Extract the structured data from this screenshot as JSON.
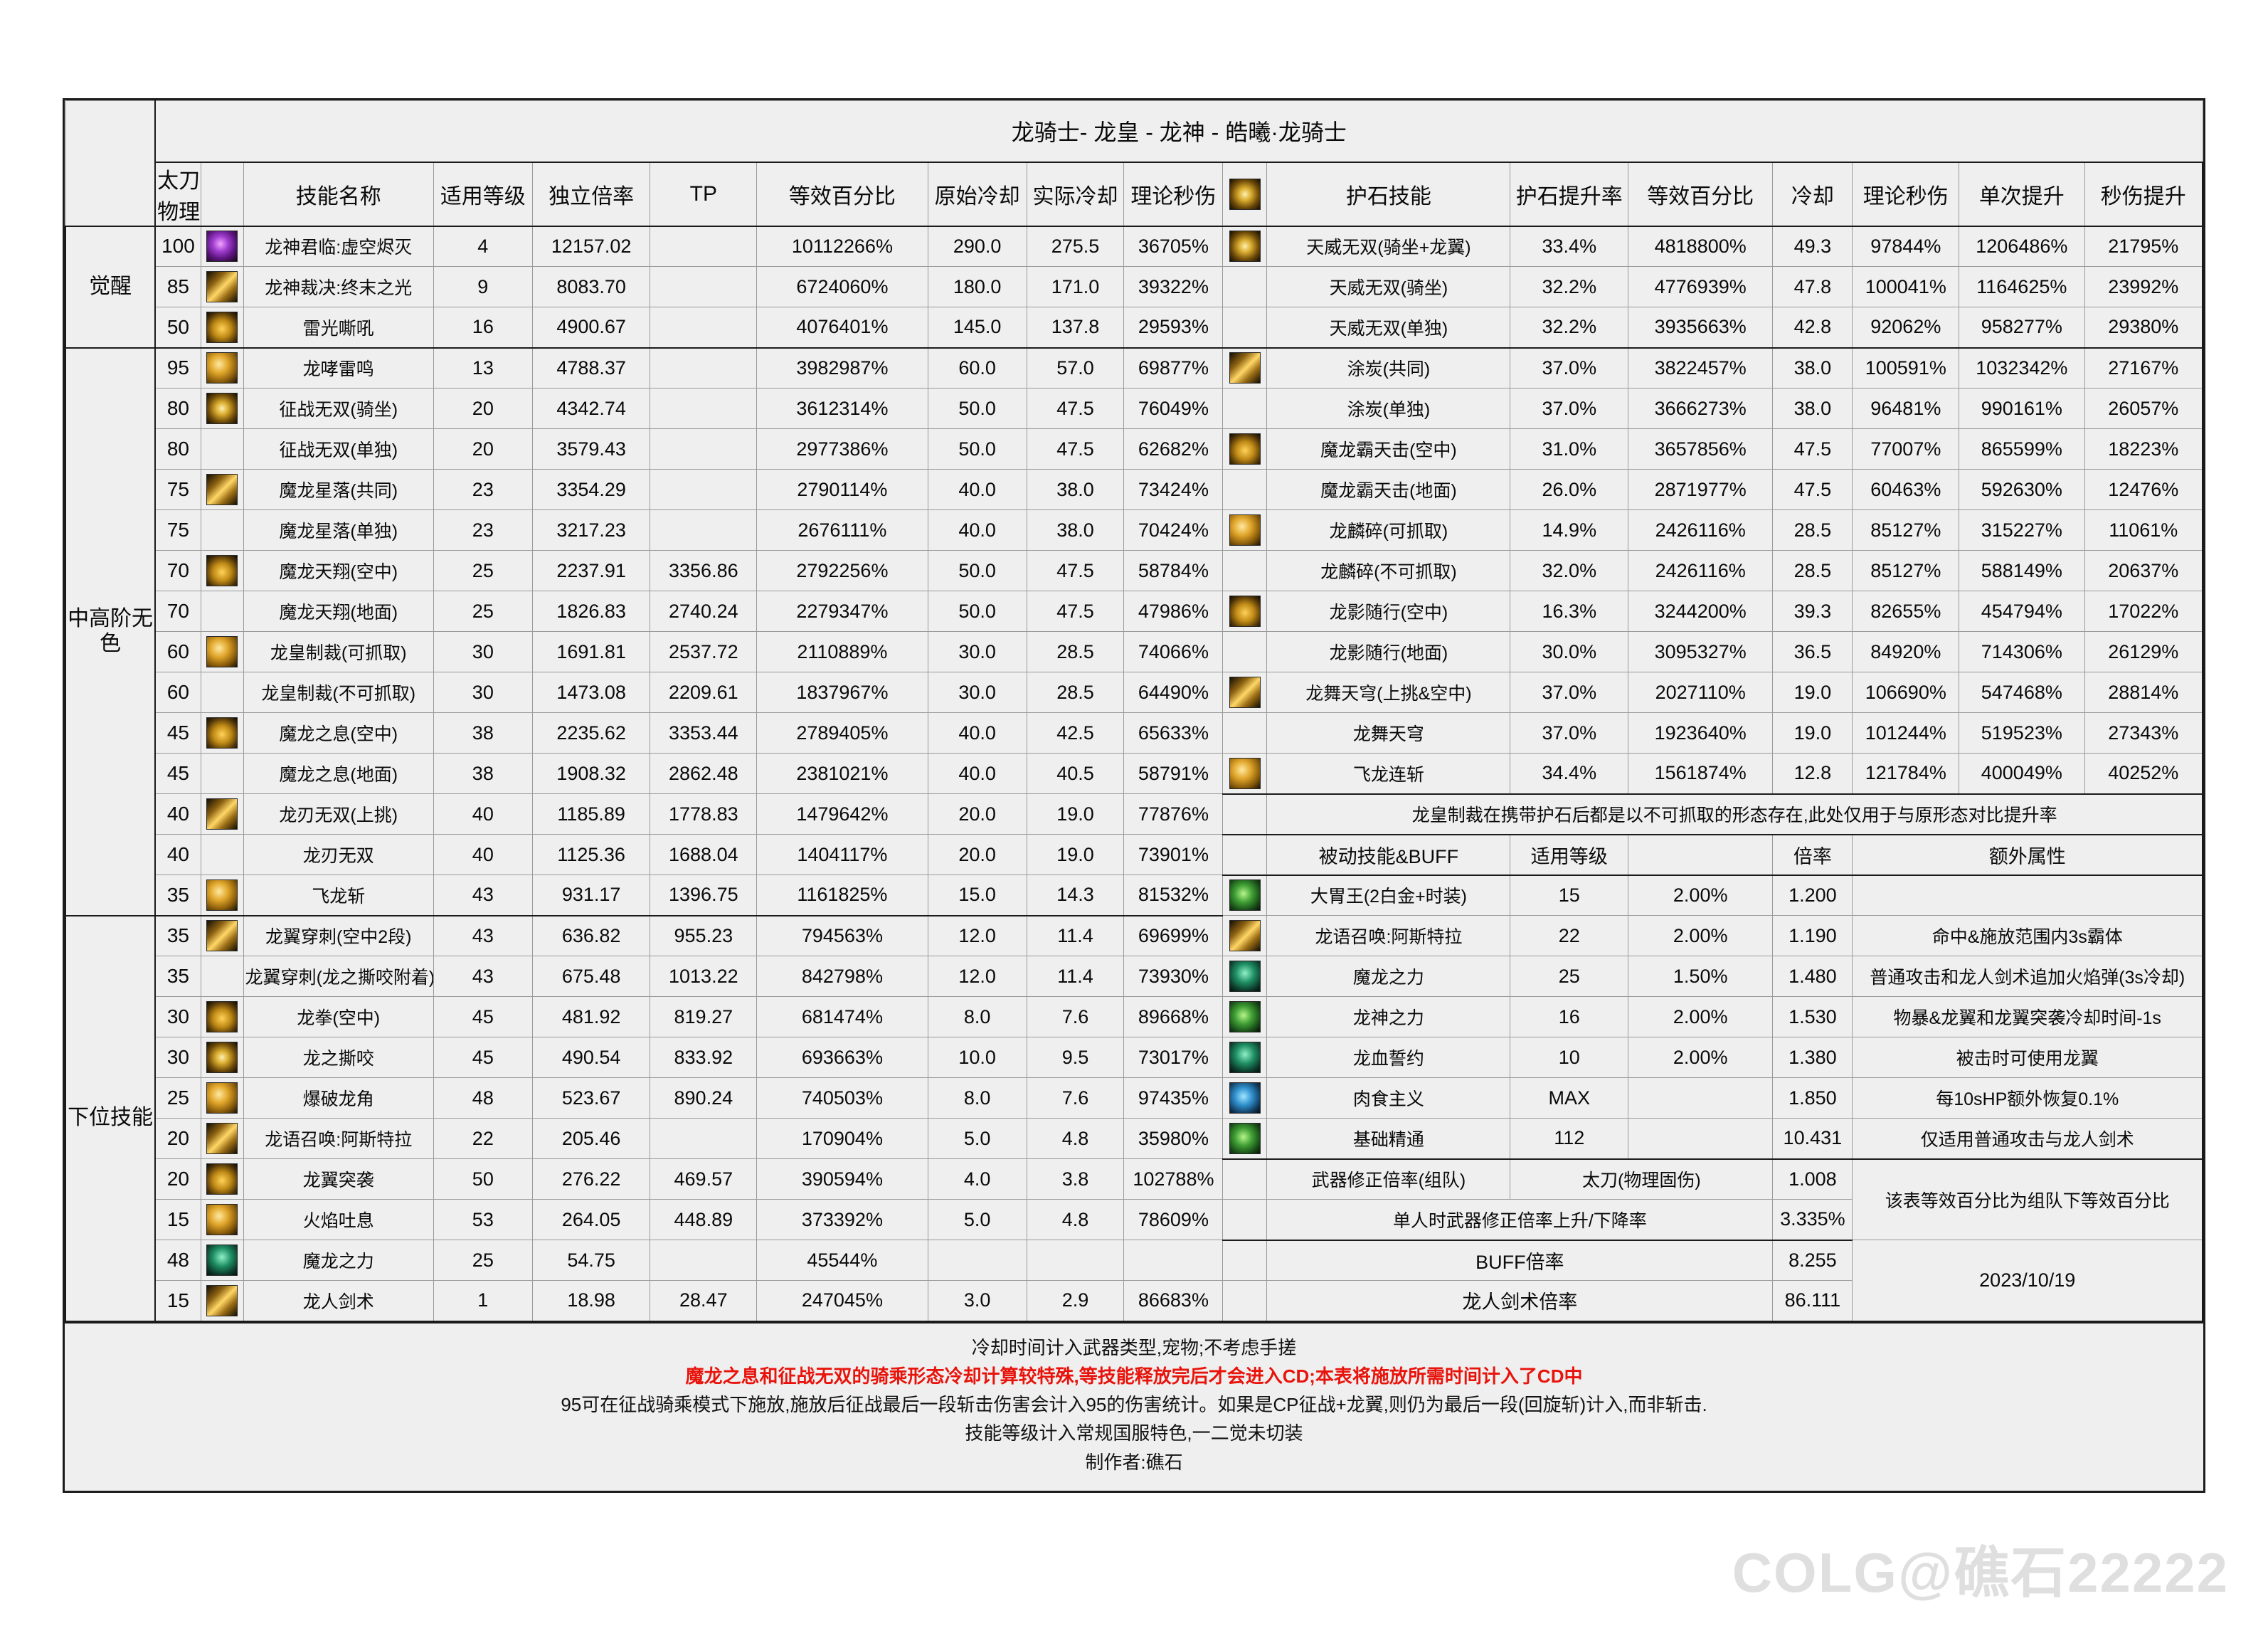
{
  "title": "龙骑士- 龙皇 - 龙神 - 皓曦·龙骑士",
  "headers": {
    "weapon": "太刀\n物理固伤",
    "weapon_l1": "太刀",
    "weapon_l2": "物理固伤",
    "skill_name": "技能名称",
    "apply_level": "适用等级",
    "independent_rate": "独立倍率",
    "tp": "TP",
    "equiv_percent": "等效百分比",
    "raw_cd": "原始冷却",
    "actual_cd": "实际冷却",
    "theoretical_dps": "理论秒伤",
    "rune_icon": "rune-star-icon",
    "rune_skill": "护石技能",
    "rune_rate": "护石提升率",
    "rune_equiv_percent": "等效百分比",
    "rune_cd": "冷却",
    "rune_dps": "理论秒伤",
    "single_gain": "单次提升",
    "dps_gain": "秒伤提升"
  },
  "groups": {
    "awakening": "觉醒",
    "mid_high": "中高阶无色",
    "lower": "下位技能"
  },
  "rows": [
    {
      "lvl": "100",
      "icon": "g-purple",
      "name": "龙神君临:虚空烬灭",
      "apply": "4",
      "rate": "12157.02",
      "tp": "",
      "equiv": "10112266%",
      "rawcd": "290.0",
      "cd": "275.5",
      "dps": "36705%"
    },
    {
      "lvl": "85",
      "icon": "g-gold2",
      "name": "龙神裁决:终末之光",
      "apply": "9",
      "rate": "8083.70",
      "tp": "",
      "equiv": "6724060%",
      "rawcd": "180.0",
      "cd": "171.0",
      "dps": "39322%"
    },
    {
      "lvl": "50",
      "icon": "g-amber",
      "name": "雷光嘶吼",
      "apply": "16",
      "rate": "4900.67",
      "tp": "",
      "equiv": "4076401%",
      "rawcd": "145.0",
      "cd": "137.8",
      "dps": "29593%"
    },
    {
      "lvl": "95",
      "icon": "g-gold",
      "name": "龙哮雷鸣",
      "apply": "13",
      "rate": "4788.37",
      "tp": "",
      "equiv": "3982987%",
      "rawcd": "60.0",
      "cd": "57.0",
      "dps": "69877%"
    },
    {
      "lvl": "80",
      "icon": "g-star",
      "name": "征战无双(骑坐)",
      "apply": "20",
      "rate": "4342.74",
      "tp": "",
      "equiv": "3612314%",
      "rawcd": "50.0",
      "cd": "47.5",
      "dps": "76049%"
    },
    {
      "lvl": "80",
      "icon": "",
      "name": "征战无双(单独)",
      "apply": "20",
      "rate": "3579.43",
      "tp": "",
      "equiv": "2977386%",
      "rawcd": "50.0",
      "cd": "47.5",
      "dps": "62682%"
    },
    {
      "lvl": "75",
      "icon": "g-gold2",
      "name": "魔龙星落(共同)",
      "apply": "23",
      "rate": "3354.29",
      "tp": "",
      "equiv": "2790114%",
      "rawcd": "40.0",
      "cd": "38.0",
      "dps": "73424%"
    },
    {
      "lvl": "75",
      "icon": "",
      "name": "魔龙星落(单独)",
      "apply": "23",
      "rate": "3217.23",
      "tp": "",
      "equiv": "2676111%",
      "rawcd": "40.0",
      "cd": "38.0",
      "dps": "70424%"
    },
    {
      "lvl": "70",
      "icon": "g-amber",
      "name": "魔龙天翔(空中)",
      "apply": "25",
      "rate": "2237.91",
      "tp": "3356.86",
      "equiv": "2792256%",
      "rawcd": "50.0",
      "cd": "47.5",
      "dps": "58784%"
    },
    {
      "lvl": "70",
      "icon": "",
      "name": "魔龙天翔(地面)",
      "apply": "25",
      "rate": "1826.83",
      "tp": "2740.24",
      "equiv": "2279347%",
      "rawcd": "50.0",
      "cd": "47.5",
      "dps": "47986%"
    },
    {
      "lvl": "60",
      "icon": "g-gold",
      "name": "龙皇制裁(可抓取)",
      "apply": "30",
      "rate": "1691.81",
      "tp": "2537.72",
      "equiv": "2110889%",
      "rawcd": "30.0",
      "cd": "28.5",
      "dps": "74066%"
    },
    {
      "lvl": "60",
      "icon": "",
      "name": "龙皇制裁(不可抓取)",
      "apply": "30",
      "rate": "1473.08",
      "tp": "2209.61",
      "equiv": "1837967%",
      "rawcd": "30.0",
      "cd": "28.5",
      "dps": "64490%"
    },
    {
      "lvl": "45",
      "icon": "g-amber",
      "name": "魔龙之息(空中)",
      "apply": "38",
      "rate": "2235.62",
      "tp": "3353.44",
      "equiv": "2789405%",
      "rawcd": "40.0",
      "cd": "42.5",
      "dps": "65633%"
    },
    {
      "lvl": "45",
      "icon": "",
      "name": "魔龙之息(地面)",
      "apply": "38",
      "rate": "1908.32",
      "tp": "2862.48",
      "equiv": "2381021%",
      "rawcd": "40.0",
      "cd": "40.5",
      "dps": "58791%"
    },
    {
      "lvl": "40",
      "icon": "g-gold2",
      "name": "龙刃无双(上挑)",
      "apply": "40",
      "rate": "1185.89",
      "tp": "1778.83",
      "equiv": "1479642%",
      "rawcd": "20.0",
      "cd": "19.0",
      "dps": "77876%"
    },
    {
      "lvl": "40",
      "icon": "",
      "name": "龙刃无双",
      "apply": "40",
      "rate": "1125.36",
      "tp": "1688.04",
      "equiv": "1404117%",
      "rawcd": "20.0",
      "cd": "19.0",
      "dps": "73901%"
    },
    {
      "lvl": "35",
      "icon": "g-gold",
      "name": "飞龙斩",
      "apply": "43",
      "rate": "931.17",
      "tp": "1396.75",
      "equiv": "1161825%",
      "rawcd": "15.0",
      "cd": "14.3",
      "dps": "81532%"
    },
    {
      "lvl": "35",
      "icon": "g-gold2",
      "name": "龙翼穿刺(空中2段)",
      "apply": "43",
      "rate": "636.82",
      "tp": "955.23",
      "equiv": "794563%",
      "rawcd": "12.0",
      "cd": "11.4",
      "dps": "69699%"
    },
    {
      "lvl": "35",
      "icon": "",
      "name": "龙翼穿刺(龙之撕咬附着)",
      "apply": "43",
      "rate": "675.48",
      "tp": "1013.22",
      "equiv": "842798%",
      "rawcd": "12.0",
      "cd": "11.4",
      "dps": "73930%"
    },
    {
      "lvl": "30",
      "icon": "g-amber",
      "name": "龙拳(空中)",
      "apply": "45",
      "rate": "481.92",
      "tp": "819.27",
      "equiv": "681474%",
      "rawcd": "8.0",
      "cd": "7.6",
      "dps": "89668%"
    },
    {
      "lvl": "30",
      "icon": "g-star",
      "name": "龙之撕咬",
      "apply": "45",
      "rate": "490.54",
      "tp": "833.92",
      "equiv": "693663%",
      "rawcd": "10.0",
      "cd": "9.5",
      "dps": "73017%"
    },
    {
      "lvl": "25",
      "icon": "g-gold",
      "name": "爆破龙角",
      "apply": "48",
      "rate": "523.67",
      "tp": "890.24",
      "equiv": "740503%",
      "rawcd": "8.0",
      "cd": "7.6",
      "dps": "97435%"
    },
    {
      "lvl": "20",
      "icon": "g-gold2",
      "name": "龙语召唤:阿斯特拉",
      "apply": "22",
      "rate": "205.46",
      "tp": "",
      "equiv": "170904%",
      "rawcd": "5.0",
      "cd": "4.8",
      "dps": "35980%"
    },
    {
      "lvl": "20",
      "icon": "g-amber",
      "name": "龙翼突袭",
      "apply": "50",
      "rate": "276.22",
      "tp": "469.57",
      "equiv": "390594%",
      "rawcd": "4.0",
      "cd": "3.8",
      "dps": "102788%"
    },
    {
      "lvl": "15",
      "icon": "g-gold",
      "name": "火焰吐息",
      "apply": "53",
      "rate": "264.05",
      "tp": "448.89",
      "equiv": "373392%",
      "rawcd": "5.0",
      "cd": "4.8",
      "dps": "78609%"
    },
    {
      "lvl": "48",
      "icon": "g-green2",
      "name": "魔龙之力",
      "apply": "25",
      "rate": "54.75",
      "tp": "",
      "equiv": "45544%",
      "rawcd": "",
      "cd": "",
      "dps": ""
    },
    {
      "lvl": "15",
      "icon": "g-gold2",
      "name": "龙人剑术",
      "apply": "1",
      "rate": "18.98",
      "tp": "28.47",
      "equiv": "247045%",
      "rawcd": "3.0",
      "cd": "2.9",
      "dps": "86683%"
    }
  ],
  "rune_rows": [
    {
      "icon": "g-star",
      "name": "天威无双(骑坐+龙翼)",
      "rate": "33.4%",
      "equiv": "4818800%",
      "cd": "49.3",
      "dps": "97844%",
      "single": "1206486%",
      "dpsgain": "21795%"
    },
    {
      "icon": "",
      "name": "天威无双(骑坐)",
      "rate": "32.2%",
      "equiv": "4776939%",
      "cd": "47.8",
      "dps": "100041%",
      "single": "1164625%",
      "dpsgain": "23992%"
    },
    {
      "icon": "",
      "name": "天威无双(单独)",
      "rate": "32.2%",
      "equiv": "3935663%",
      "cd": "42.8",
      "dps": "92062%",
      "single": "958277%",
      "dpsgain": "29380%"
    },
    {
      "icon": "g-gold2",
      "name": "涂炭(共同)",
      "rate": "37.0%",
      "equiv": "3822457%",
      "cd": "38.0",
      "dps": "100591%",
      "single": "1032342%",
      "dpsgain": "27167%"
    },
    {
      "icon": "",
      "name": "涂炭(单独)",
      "rate": "37.0%",
      "equiv": "3666273%",
      "cd": "38.0",
      "dps": "96481%",
      "single": "990161%",
      "dpsgain": "26057%"
    },
    {
      "icon": "g-amber",
      "name": "魔龙霸天击(空中)",
      "rate": "31.0%",
      "equiv": "3657856%",
      "cd": "47.5",
      "dps": "77007%",
      "single": "865599%",
      "dpsgain": "18223%"
    },
    {
      "icon": "",
      "name": "魔龙霸天击(地面)",
      "rate": "26.0%",
      "equiv": "2871977%",
      "cd": "47.5",
      "dps": "60463%",
      "single": "592630%",
      "dpsgain": "12476%"
    },
    {
      "icon": "g-gold",
      "name": "龙麟碎(可抓取)",
      "rate": "14.9%",
      "equiv": "2426116%",
      "cd": "28.5",
      "dps": "85127%",
      "single": "315227%",
      "dpsgain": "11061%"
    },
    {
      "icon": "",
      "name": "龙麟碎(不可抓取)",
      "rate": "32.0%",
      "equiv": "2426116%",
      "cd": "28.5",
      "dps": "85127%",
      "single": "588149%",
      "dpsgain": "20637%"
    },
    {
      "icon": "g-amber",
      "name": "龙影随行(空中)",
      "rate": "16.3%",
      "equiv": "3244200%",
      "cd": "39.3",
      "dps": "82655%",
      "single": "454794%",
      "dpsgain": "17022%"
    },
    {
      "icon": "",
      "name": "龙影随行(地面)",
      "rate": "30.0%",
      "equiv": "3095327%",
      "cd": "36.5",
      "dps": "84920%",
      "single": "714306%",
      "dpsgain": "26129%"
    },
    {
      "icon": "g-gold2",
      "name": "龙舞天穹(上挑&空中)",
      "rate": "37.0%",
      "equiv": "2027110%",
      "cd": "19.0",
      "dps": "106690%",
      "single": "547468%",
      "dpsgain": "28814%"
    },
    {
      "icon": "",
      "name": "龙舞天穹",
      "rate": "37.0%",
      "equiv": "1923640%",
      "cd": "19.0",
      "dps": "101244%",
      "single": "519523%",
      "dpsgain": "27343%"
    },
    {
      "icon": "g-gold",
      "name": "飞龙连斩",
      "rate": "34.4%",
      "equiv": "1561874%",
      "cd": "12.8",
      "dps": "121784%",
      "single": "400049%",
      "dpsgain": "40252%"
    }
  ],
  "rune_note": "龙皇制裁在携带护石后都是以不可抓取的形态存在,此处仅用于与原形态对比提升率",
  "passive_header": {
    "name": "被动技能&BUFF",
    "apply": "适用等级",
    "blank": "",
    "rate": "倍率",
    "extra": "额外属性"
  },
  "passives": [
    {
      "icon": "g-green",
      "name": "大胃王(2白金+时装)",
      "apply": "15",
      "pct": "2.00%",
      "rate": "1.200",
      "extra": ""
    },
    {
      "icon": "g-gold2",
      "name": "龙语召唤:阿斯特拉",
      "apply": "22",
      "pct": "2.00%",
      "rate": "1.190",
      "extra": "命中&施放范围内3s霸体"
    },
    {
      "icon": "g-green2",
      "name": "魔龙之力",
      "apply": "25",
      "pct": "1.50%",
      "rate": "1.480",
      "extra": "普通攻击和龙人剑术追加火焰弹(3s冷却)"
    },
    {
      "icon": "g-green",
      "name": "龙神之力",
      "apply": "16",
      "pct": "2.00%",
      "rate": "1.530",
      "extra": "物暴&龙翼和龙翼突袭冷却时间-1s"
    },
    {
      "icon": "g-green2",
      "name": "龙血誓约",
      "apply": "10",
      "pct": "2.00%",
      "rate": "1.380",
      "extra": "被击时可使用龙翼"
    },
    {
      "icon": "g-blue",
      "name": "肉食主义",
      "apply": "MAX",
      "pct": "",
      "rate": "1.850",
      "extra": "每10sHP额外恢复0.1%"
    },
    {
      "icon": "g-green",
      "name": "基础精通",
      "apply": "112",
      "pct": "",
      "rate": "10.431",
      "extra": "仅适用普通攻击与龙人剑术"
    }
  ],
  "footer_rows": {
    "weapon_fix_label": "武器修正倍率(组队)",
    "weapon_fix_value": "太刀(物理固伤)",
    "weapon_fix_rate": "1.008",
    "solo_label": "单人时武器修正倍率上升/下降率",
    "solo_rate": "3.335%",
    "group_note": "该表等效百分比为组队下等效百分比",
    "buff_label": "BUFF倍率",
    "buff_rate": "8.255",
    "dragon_sword_label": "龙人剑术倍率",
    "dragon_sword_rate": "86.111",
    "date": "2023/10/19"
  },
  "notes": {
    "line1": "冷却时间计入武器类型,宠物;不考虑手搓",
    "line2": "魔龙之息和征战无双的骑乘形态冷却计算较特殊,等技能释放完后才会进入CD;本表将施放所需时间计入了CD中",
    "line3": "95可在征战骑乘模式下施放,施放后征战最后一段斩击伤害会计入95的伤害统计。如果是CP征战+龙翼,则仍为最后一段(回旋斩)计入,而非斩击.",
    "line4": "技能等级计入常规国服特色,一二觉未切装",
    "line5": "制作者:礁石"
  },
  "watermark": "COLG@礁石22222"
}
